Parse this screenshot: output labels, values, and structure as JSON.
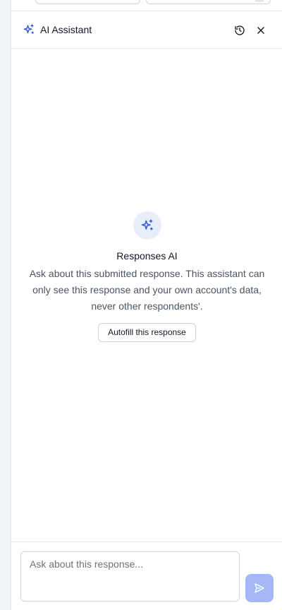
{
  "header": {
    "title": "AI Assistant",
    "icons": {
      "brand": "sparkle-icon",
      "history": "history-icon",
      "close": "close-icon"
    }
  },
  "empty_state": {
    "icon": "sparkle-icon",
    "title": "Responses AI",
    "description": "Ask about this submitted response. This assistant can only see this response and your own account's data, never other respondents'.",
    "action_label": "Autofill this response"
  },
  "composer": {
    "placeholder": "Ask about this response...",
    "value": "",
    "send_icon": "send-icon"
  },
  "colors": {
    "accent": "#2f5bd3",
    "send_disabled": "#a5b8f5",
    "sidebar_bg": "#f1f4f9",
    "bubble_bg": "#e8eef9"
  }
}
